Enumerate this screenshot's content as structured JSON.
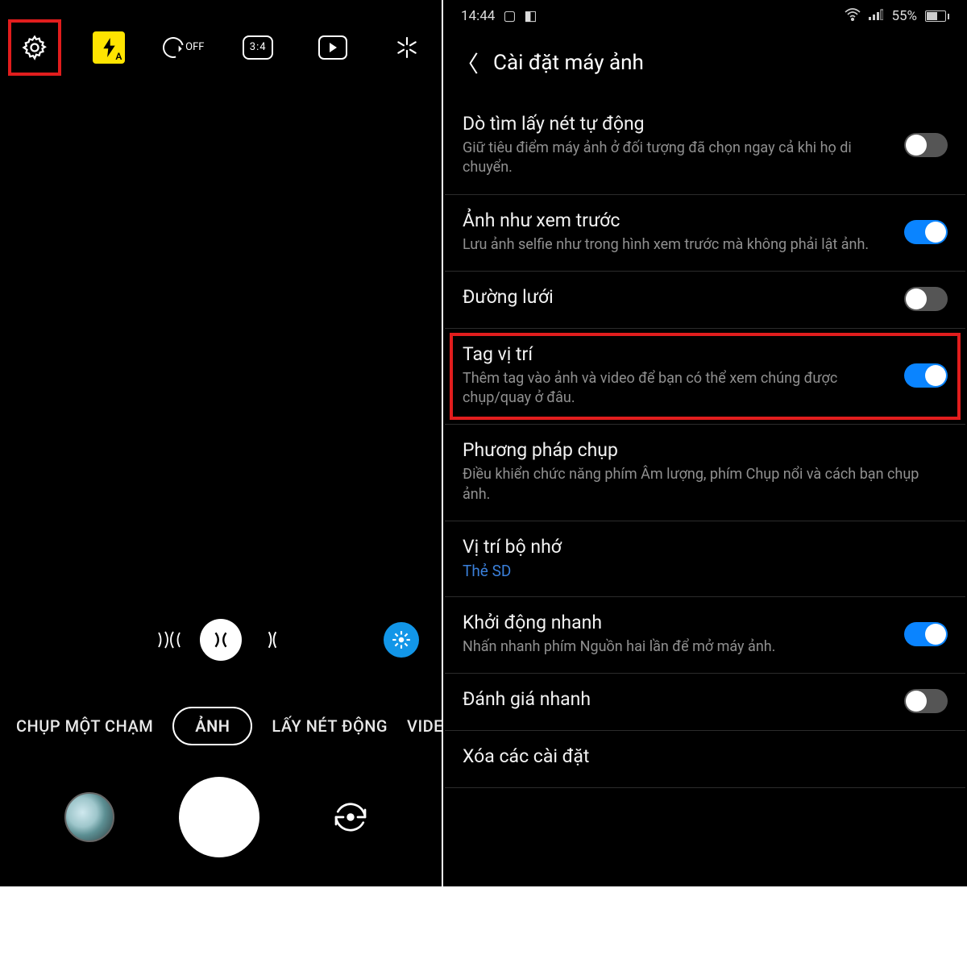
{
  "camera": {
    "top_icons": {
      "settings": "gear",
      "flash_sub": "A",
      "timer_label": "OFF",
      "ratio": "3:4"
    },
    "modes": [
      "CHỤP MỘT CHẠM",
      "ẢNH",
      "LẤY NÉT ĐỘNG",
      "VIDEO"
    ],
    "active_mode_index": 1
  },
  "status": {
    "time": "14:44",
    "battery_pct": "55%"
  },
  "settings_title": "Cài đặt máy ảnh",
  "items": [
    {
      "title": "Dò tìm lấy nét tự động",
      "desc": "Giữ tiêu điểm máy ảnh ở đối tượng đã chọn ngay cả khi họ di chuyển.",
      "toggle": false
    },
    {
      "title": "Ảnh như xem trước",
      "desc": "Lưu ảnh selfie như trong hình xem trước mà không phải lật ảnh.",
      "toggle": true
    },
    {
      "title": "Đường lưới",
      "desc": "",
      "toggle": false
    },
    {
      "title": "Tag vị trí",
      "desc": "Thêm tag vào ảnh và video để bạn có thể xem chúng được chụp/quay ở đâu.",
      "toggle": true,
      "highlighted": true
    },
    {
      "title": "Phương pháp chụp",
      "desc": "Điều khiển chức năng phím Âm lượng, phím Chụp nổi và cách bạn chụp ảnh."
    },
    {
      "title": "Vị trí bộ nhớ",
      "link": "Thẻ SD"
    },
    {
      "title": "Khởi động nhanh",
      "desc": "Nhấn nhanh phím Nguồn hai lần để mở máy ảnh.",
      "toggle": true
    },
    {
      "title": "Đánh giá nhanh",
      "desc": "",
      "toggle": false
    },
    {
      "title": "Xóa các cài đặt",
      "desc": ""
    }
  ]
}
